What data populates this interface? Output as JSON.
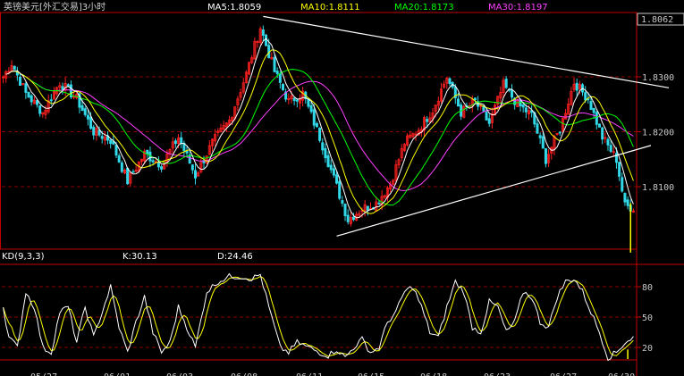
{
  "colors": {
    "background": "#000000",
    "frame": "#c00000",
    "grid": "#8b0000",
    "bull": "#ff2020",
    "bear": "#30d8e8",
    "ma5": "#ffffff",
    "ma10": "#ffff00",
    "ma20": "#00ff00",
    "ma30": "#ff40ff",
    "k_line": "#ffffff",
    "d_line": "#ffff00",
    "trendline": "#ffffff",
    "axis_text": "#c8c8c8"
  },
  "header": {
    "title": "英镑美元[外汇交易]3小时",
    "ma5": "MA5:1.8059",
    "ma10": "MA10:1.8111",
    "ma20": "MA20:1.8173",
    "ma30": "MA30:1.8197"
  },
  "kd_header": {
    "name": "KD(9,3,3)",
    "k": "K:30.13",
    "d": "D:24.46"
  },
  "chart_data": [
    {
      "type": "candlestick",
      "y_ticks": [
        1.81,
        1.82,
        1.83
      ],
      "y_tick_labels": [
        "1.8100",
        "1.8200",
        "1.8300"
      ],
      "last_price_label": "1.8062",
      "ylim": [
        1.8005,
        1.8075
      ],
      "grid": true,
      "x_tick_labels": [
        "05/27",
        "06/01",
        "06/03",
        "06/08",
        "06/11",
        "06/15",
        "06/18",
        "06/23",
        "06/27",
        "06/30"
      ],
      "anchors": [
        [
          0,
          1.83
        ],
        [
          3,
          1.8325
        ],
        [
          8,
          1.827
        ],
        [
          14,
          1.8235
        ],
        [
          20,
          1.829
        ],
        [
          26,
          1.826
        ],
        [
          32,
          1.82
        ],
        [
          38,
          1.8185
        ],
        [
          44,
          1.811
        ],
        [
          50,
          1.816
        ],
        [
          56,
          1.814
        ],
        [
          62,
          1.819
        ],
        [
          68,
          1.812
        ],
        [
          74,
          1.818
        ],
        [
          80,
          1.822
        ],
        [
          86,
          1.8305
        ],
        [
          91,
          1.839
        ],
        [
          96,
          1.831
        ],
        [
          101,
          1.8255
        ],
        [
          106,
          1.827
        ],
        [
          112,
          1.819
        ],
        [
          118,
          1.81
        ],
        [
          122,
          1.804
        ],
        [
          127,
          1.806
        ],
        [
          132,
          1.807
        ],
        [
          137,
          1.8105
        ],
        [
          142,
          1.818
        ],
        [
          147,
          1.8205
        ],
        [
          152,
          1.824
        ],
        [
          157,
          1.83
        ],
        [
          162,
          1.8235
        ],
        [
          167,
          1.8255
        ],
        [
          172,
          1.8215
        ],
        [
          177,
          1.8285
        ],
        [
          182,
          1.825
        ],
        [
          187,
          1.823
        ],
        [
          192,
          1.815
        ],
        [
          197,
          1.8205
        ],
        [
          202,
          1.829
        ],
        [
          207,
          1.826
        ],
        [
          212,
          1.819
        ],
        [
          217,
          1.815
        ],
        [
          220,
          1.8065
        ],
        [
          223,
          1.8062
        ]
      ],
      "triangle": {
        "upper": [
          [
            92,
            1.841
          ],
          [
            240,
            1.828
          ]
        ],
        "lower": [
          [
            118,
            1.801
          ],
          [
            240,
            1.8175
          ]
        ]
      }
    },
    {
      "type": "line",
      "name": "KD(9,3,3)",
      "y_ticks": [
        20,
        50,
        80
      ],
      "ylim": [
        0,
        100
      ],
      "grid": true,
      "k_anchors": [
        [
          0,
          60
        ],
        [
          2,
          30
        ],
        [
          5,
          20
        ],
        [
          8,
          75
        ],
        [
          11,
          60
        ],
        [
          14,
          20
        ],
        [
          17,
          15
        ],
        [
          20,
          55
        ],
        [
          23,
          60
        ],
        [
          26,
          25
        ],
        [
          29,
          60
        ],
        [
          32,
          30
        ],
        [
          35,
          55
        ],
        [
          38,
          80
        ],
        [
          41,
          40
        ],
        [
          44,
          15
        ],
        [
          47,
          45
        ],
        [
          50,
          70
        ],
        [
          53,
          35
        ],
        [
          56,
          15
        ],
        [
          59,
          25
        ],
        [
          62,
          60
        ],
        [
          65,
          40
        ],
        [
          68,
          20
        ],
        [
          72,
          75
        ],
        [
          76,
          85
        ],
        [
          80,
          90
        ],
        [
          84,
          90
        ],
        [
          88,
          88
        ],
        [
          91,
          92
        ],
        [
          94,
          60
        ],
        [
          98,
          20
        ],
        [
          101,
          15
        ],
        [
          104,
          25
        ],
        [
          108,
          20
        ],
        [
          112,
          15
        ],
        [
          115,
          12
        ],
        [
          118,
          18
        ],
        [
          121,
          10
        ],
        [
          124,
          20
        ],
        [
          127,
          28
        ],
        [
          130,
          15
        ],
        [
          133,
          20
        ],
        [
          136,
          45
        ],
        [
          139,
          55
        ],
        [
          142,
          75
        ],
        [
          145,
          80
        ],
        [
          148,
          60
        ],
        [
          151,
          35
        ],
        [
          154,
          30
        ],
        [
          157,
          60
        ],
        [
          160,
          85
        ],
        [
          163,
          75
        ],
        [
          166,
          40
        ],
        [
          169,
          35
        ],
        [
          172,
          65
        ],
        [
          175,
          60
        ],
        [
          178,
          35
        ],
        [
          181,
          45
        ],
        [
          184,
          75
        ],
        [
          187,
          70
        ],
        [
          190,
          45
        ],
        [
          193,
          40
        ],
        [
          196,
          70
        ],
        [
          199,
          85
        ],
        [
          202,
          88
        ],
        [
          205,
          75
        ],
        [
          208,
          55
        ],
        [
          211,
          35
        ],
        [
          214,
          10
        ],
        [
          217,
          15
        ],
        [
          220,
          25
        ],
        [
          223,
          30
        ]
      ]
    }
  ]
}
